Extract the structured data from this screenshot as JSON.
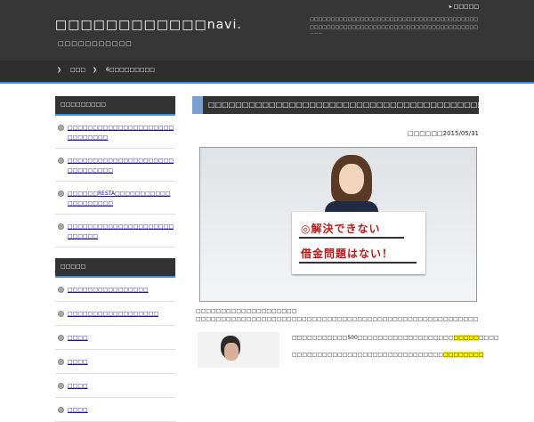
{
  "header": {
    "site_title": "□□□□□□□□□□□□navi.",
    "tagline": "□□□□□□□□□□□",
    "top_link": "▸ □□□□□",
    "description": "□□□□□□□□□□□□□□□□□□□□□□□□□□□□□□□□□□□□□□□□□□□□□□□□□□□□□□□□□□□□□□□□□□□□□□□□□□□□□□□□□□□"
  },
  "nav": {
    "items": [
      {
        "chevron": "❯",
        "label": "□□□"
      },
      {
        "chevron": "❯",
        "label": "6□□□□□□□□□"
      }
    ]
  },
  "sidebar": {
    "section1": {
      "heading": "□□□□□□□□□",
      "items": [
        "□□□□□□□□□□□□□□□□□□□□□□□□□□□□□",
        "□□□□□□□□□□□□□□□□□□□□□□□□□□□□□□",
        "□□□□□□RESTA□□□□□□□□□□□□□□□□□□□□",
        "□□□□□□□□□□□□□□□□□□□□□□□□□□□"
      ]
    },
    "section2": {
      "heading": "□□□□□",
      "items": [
        "□□□□□□□□□□□□□□□□",
        "□□□□□□□□□□□□□□□□□□",
        "□□□□",
        "□□□□",
        "□□□□",
        "□□□□"
      ]
    }
  },
  "post": {
    "title": "□□□□□□□□□□□□□□□□□□□□□□□□□□□□□□□□□□□□□□□□□□",
    "date": "□□□□□□2015/05/31",
    "hero": {
      "sign_line1": "◎解決できない",
      "sign_line2": "借金問題はない！"
    },
    "para1_line1": "□□□□□□□□□□□□□□□□□□□□",
    "para1_line2": "□□□□□□□□□□□□□□□□□□□□□□□□□□□□□□□□□□□□□□□□□□□□□□□□□□□□□□□□□□□□□□□□□□□",
    "para2_pre": "□□□□□□□□□□□500□□□□□□□□□□□□□□□□□□□",
    "para2_hl": "□□□□□",
    "para2_post": "□□□□",
    "para3_pre": "□□□□□□□□□□□□□□□□□□□□□□□□□□□□□□",
    "para3_hl": "□□□□□□□□"
  }
}
